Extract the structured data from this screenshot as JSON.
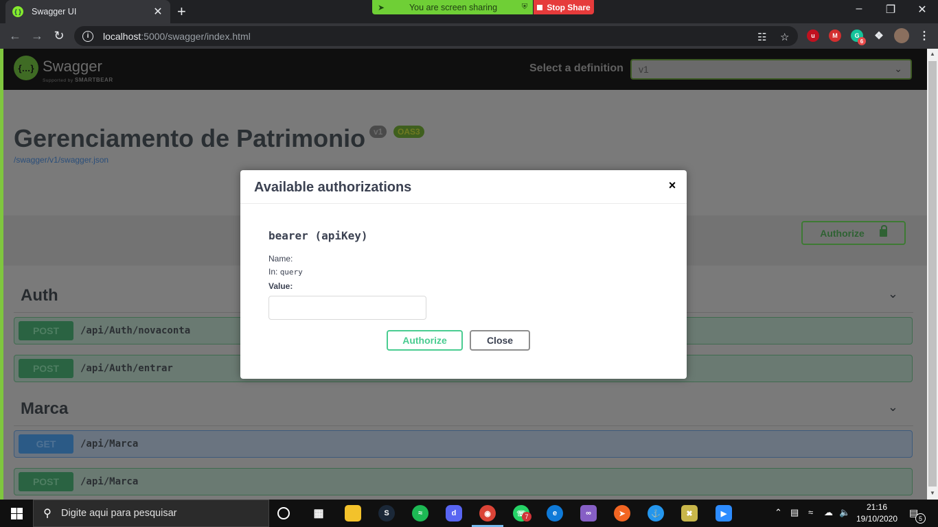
{
  "browser": {
    "tab_title": "Swagger UI",
    "new_tab": "+",
    "url_host": "localhost",
    "url_rest": ":5000/swagger/index.html",
    "minimize": "–",
    "restore": "❐",
    "close": "✕"
  },
  "screen_share": {
    "message": "You are screen sharing",
    "stop_label": "Stop Share"
  },
  "extensions": {
    "grammarly_badge": "6"
  },
  "swagger": {
    "logo_text": "Swagger",
    "logo_sub_prefix": "Supported by",
    "logo_sub_brand": "SMARTBEAR",
    "select_definition_label": "Select a definition",
    "definition_value": "v1",
    "title": "Gerenciamento de Patrimonio",
    "version_badge": "v1",
    "oas_badge": "OAS3",
    "spec_link": "/swagger/v1/swagger.json",
    "authorize_label": "Authorize"
  },
  "tags": [
    {
      "name": "Auth",
      "operations": [
        {
          "method": "POST",
          "path": "/api/Auth/novaconta"
        },
        {
          "method": "POST",
          "path": "/api/Auth/entrar"
        }
      ]
    },
    {
      "name": "Marca",
      "operations": [
        {
          "method": "GET",
          "path": "/api/Marca"
        },
        {
          "method": "POST",
          "path": "/api/Marca"
        }
      ]
    }
  ],
  "modal": {
    "title": "Available authorizations",
    "close_icon": "×",
    "scheme_name": "bearer",
    "scheme_type": "(apiKey)",
    "name_label": "Name:",
    "in_label": "In:",
    "in_value": "query",
    "value_label": "Value:",
    "value_input": "",
    "authorize_button": "Authorize",
    "close_button": "Close"
  },
  "taskbar": {
    "search_placeholder": "Digite aqui para pesquisar",
    "whatsapp_badge": "7",
    "time": "21:16",
    "date": "19/10/2020",
    "notification_count": "5"
  },
  "colors": {
    "post_accent": "#49cc90",
    "get_accent": "#61affe",
    "share_banner": "#6fcf36",
    "stop_share": "#e63b3b",
    "swagger_green": "#85ea2d"
  }
}
